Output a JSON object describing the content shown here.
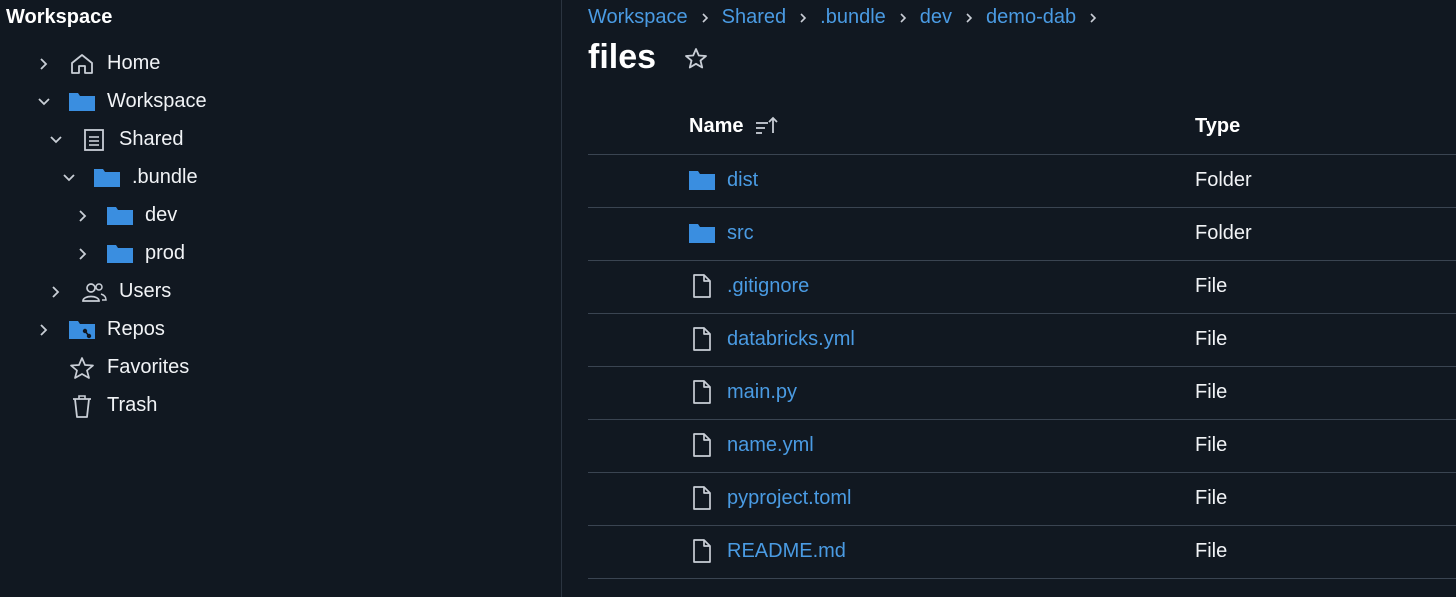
{
  "sidebar": {
    "title": "Workspace",
    "items": [
      {
        "label": "Home",
        "icon": "home-icon",
        "chevron": "right"
      },
      {
        "label": "Workspace",
        "icon": "folder-icon",
        "chevron": "down"
      },
      {
        "label": "Shared",
        "icon": "shared-doc-icon",
        "chevron": "down"
      },
      {
        "label": ".bundle",
        "icon": "folder-icon",
        "chevron": "down"
      },
      {
        "label": "dev",
        "icon": "folder-icon",
        "chevron": "right"
      },
      {
        "label": "prod",
        "icon": "folder-icon",
        "chevron": "right"
      },
      {
        "label": "Users",
        "icon": "users-icon",
        "chevron": "right"
      },
      {
        "label": "Repos",
        "icon": "repo-folder-icon",
        "chevron": "right"
      },
      {
        "label": "Favorites",
        "icon": "star-icon",
        "chevron": ""
      },
      {
        "label": "Trash",
        "icon": "trash-icon",
        "chevron": ""
      }
    ]
  },
  "breadcrumb": [
    "Workspace",
    "Shared",
    ".bundle",
    "dev",
    "demo-dab"
  ],
  "page": {
    "title": "files"
  },
  "table": {
    "headers": {
      "name": "Name",
      "type": "Type"
    },
    "rows": [
      {
        "name": "dist",
        "type": "Folder",
        "icon": "folder-icon"
      },
      {
        "name": "src",
        "type": "Folder",
        "icon": "folder-icon"
      },
      {
        "name": ".gitignore",
        "type": "File",
        "icon": "file-icon"
      },
      {
        "name": "databricks.yml",
        "type": "File",
        "icon": "file-icon"
      },
      {
        "name": "main.py",
        "type": "File",
        "icon": "file-icon"
      },
      {
        "name": "name.yml",
        "type": "File",
        "icon": "file-icon"
      },
      {
        "name": "pyproject.toml",
        "type": "File",
        "icon": "file-icon"
      },
      {
        "name": "README.md",
        "type": "File",
        "icon": "file-icon"
      }
    ]
  },
  "colors": {
    "background": "#111821",
    "link": "#4a9be3",
    "folder": "#3a8ee0",
    "text": "#f1f3f6",
    "divider": "#3a4451"
  }
}
